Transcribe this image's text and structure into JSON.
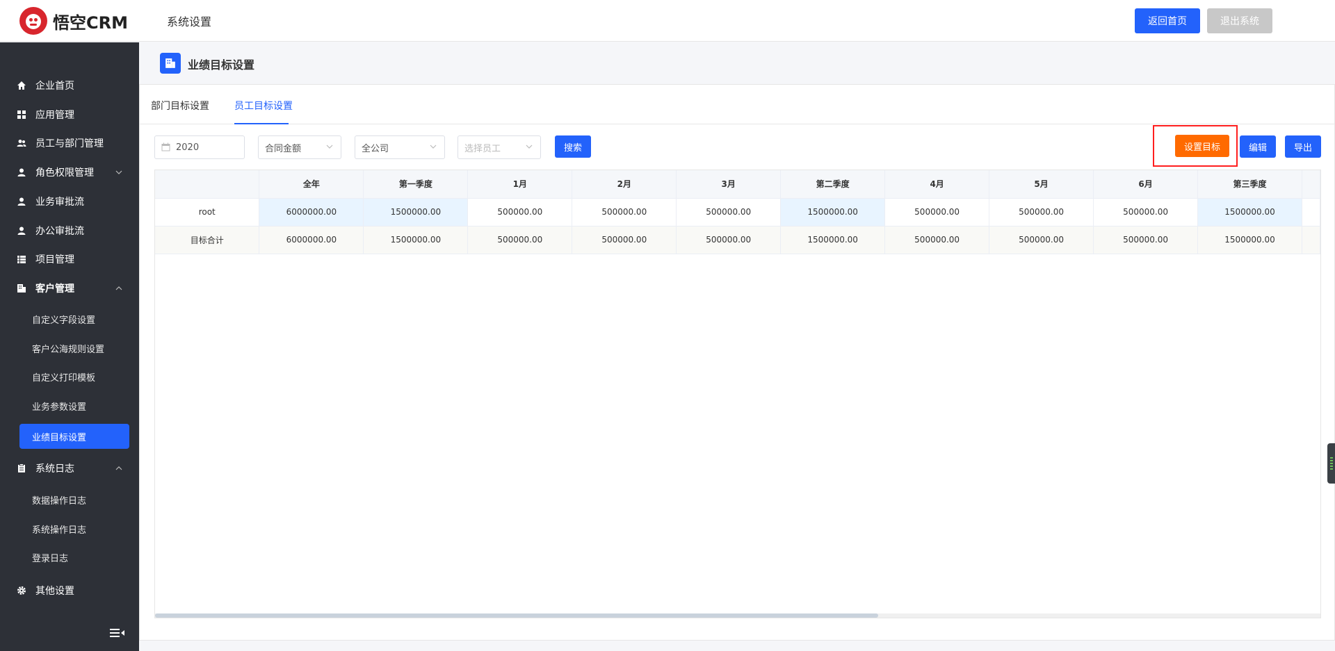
{
  "header": {
    "logo_text": "悟空CRM",
    "title": "系统设置",
    "home_label": "返回首页",
    "exit_label": "退出系统"
  },
  "sidebar": {
    "items": [
      {
        "label": "企业首页",
        "icon": "home-icon"
      },
      {
        "label": "应用管理",
        "icon": "grid-icon"
      },
      {
        "label": "员工与部门管理",
        "icon": "users-icon"
      },
      {
        "label": "角色权限管理",
        "icon": "user-icon"
      },
      {
        "label": "业务审批流",
        "icon": "user-icon"
      },
      {
        "label": "办公审批流",
        "icon": "user-icon"
      },
      {
        "label": "项目管理",
        "icon": "list-icon"
      },
      {
        "label": "客户管理",
        "icon": "building-icon"
      },
      {
        "label": "系统日志",
        "icon": "clipboard-icon"
      },
      {
        "label": "其他设置",
        "icon": "gear-icon"
      }
    ],
    "customer_sub": [
      "自定义字段设置",
      "客户公海规则设置",
      "自定义打印模板",
      "业务参数设置",
      "业绩目标设置"
    ],
    "log_sub": [
      "数据操作日志",
      "系统操作日志",
      "登录日志"
    ]
  },
  "page": {
    "title": "业绩目标设置"
  },
  "tabs": [
    "部门目标设置",
    "员工目标设置"
  ],
  "filters": {
    "year": "2020",
    "type": "合同金额",
    "scope": "全公司",
    "employee_placeholder": "选择员工",
    "search_label": "搜索"
  },
  "actions": {
    "set_label": "设置目标",
    "edit_label": "编辑",
    "export_label": "导出"
  },
  "table": {
    "columns": [
      "全年",
      "第一季度",
      "1月",
      "2月",
      "3月",
      "第二季度",
      "4月",
      "5月",
      "6月",
      "第三季度"
    ],
    "rows": [
      {
        "name": "root",
        "values": [
          "6000000.00",
          "1500000.00",
          "500000.00",
          "500000.00",
          "500000.00",
          "1500000.00",
          "500000.00",
          "500000.00",
          "500000.00",
          "1500000.00"
        ]
      },
      {
        "name": "目标合计",
        "values": [
          "6000000.00",
          "1500000.00",
          "500000.00",
          "500000.00",
          "500000.00",
          "1500000.00",
          "500000.00",
          "500000.00",
          "500000.00",
          "1500000.00"
        ]
      }
    ]
  },
  "colors": {
    "primary": "#2362fb",
    "sidebar_bg": "#2d3037",
    "orange": "#ff6a00",
    "highlight_border": "#ff1e1e",
    "quarter_cell": "#e8f4ff"
  }
}
